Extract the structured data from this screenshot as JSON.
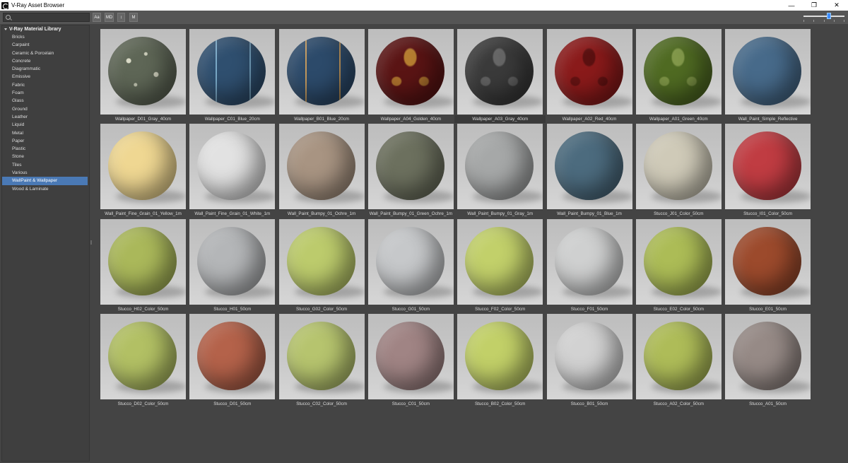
{
  "window": {
    "title": "V-Ray Asset Browser",
    "controls": [
      "—",
      "❐",
      "✕"
    ]
  },
  "toolbar": {
    "search_placeholder": "",
    "buttons": [
      "Aa",
      "MD",
      "↕",
      "M"
    ],
    "zoom_level": 0.62
  },
  "sidebar": {
    "root_label": "V-Ray Material Library",
    "items": [
      "Bricks",
      "Carpaint",
      "Ceramic & Porcelain",
      "Concrete",
      "Diagrammatic",
      "Emissive",
      "Fabric",
      "Foam",
      "Glass",
      "Ground",
      "Leather",
      "Liquid",
      "Metal",
      "Paper",
      "Plastic",
      "Stone",
      "Tiles",
      "Various",
      "WallPaint & Wallpaper",
      "Wood & Laminate"
    ],
    "selected_index": 18
  },
  "materials": [
    {
      "name": "Wallpaper_D01_Gray_40cm",
      "color": "#5e6656",
      "pattern": "flower"
    },
    {
      "name": "Wallpaper_C01_Blue_20cm",
      "color": "#2f4f6f",
      "pattern": "lines-blue"
    },
    {
      "name": "Wallpaper_B01_Blue_20cm",
      "color": "#2c4a6a",
      "pattern": "lines-gold"
    },
    {
      "name": "Wallpaper_A04_Golden_40cm",
      "color": "#5a1414",
      "pattern": "damask-gold"
    },
    {
      "name": "Wallpaper_A03_Gray_40cm",
      "color": "#3a3a3a",
      "pattern": "damask-gray"
    },
    {
      "name": "Wallpaper_A02_Red_40cm",
      "color": "#8a1a1a",
      "pattern": "damask-red"
    },
    {
      "name": "Wallpaper_A01_Green_40cm",
      "color": "#4f6a22",
      "pattern": "damask-green"
    },
    {
      "name": "Wall_Paint_Simple_Reflective",
      "color": "#476a8a",
      "pattern": "none"
    },
    {
      "name": "Wall_Paint_Fine_Grain_01_Yellow_1m",
      "color": "#efd792",
      "pattern": "none"
    },
    {
      "name": "Wall_Paint_Fine_Grain_01_White_1m",
      "color": "#e2e2e2",
      "pattern": "none"
    },
    {
      "name": "Wall_Paint_Bumpy_01_Ochre_1m",
      "color": "#a89482",
      "pattern": "none"
    },
    {
      "name": "Wall_Paint_Bumpy_01_Green_Ochre_1m",
      "color": "#6c705e",
      "pattern": "none"
    },
    {
      "name": "Wall_Paint_Bumpy_01_Gray_1m",
      "color": "#a6a8a8",
      "pattern": "none"
    },
    {
      "name": "Wall_Paint_Bumpy_01_Blue_1m",
      "color": "#4c6b7e",
      "pattern": "none"
    },
    {
      "name": "Stucco_J01_Color_50cm",
      "color": "#cfcab8",
      "pattern": "none"
    },
    {
      "name": "Stucco_I01_Color_50cm",
      "color": "#c03c42",
      "pattern": "none"
    },
    {
      "name": "Stucco_H02_Color_50cm",
      "color": "#aab85a",
      "pattern": "none"
    },
    {
      "name": "Stucco_H01_50cm",
      "color": "#b4b6b8",
      "pattern": "none"
    },
    {
      "name": "Stucco_G02_Color_50cm",
      "color": "#bccb6c",
      "pattern": "none"
    },
    {
      "name": "Stucco_G01_50cm",
      "color": "#c6c8ca",
      "pattern": "none"
    },
    {
      "name": "Stucco_F02_Color_50cm",
      "color": "#c2d06a",
      "pattern": "none"
    },
    {
      "name": "Stucco_F01_50cm",
      "color": "#cfd0d0",
      "pattern": "none"
    },
    {
      "name": "Stucco_E02_Color_50cm",
      "color": "#acbc56",
      "pattern": "none"
    },
    {
      "name": "Stucco_E01_50cm",
      "color": "#9c4a2c",
      "pattern": "none"
    },
    {
      "name": "Stucco_D02_Color_50cm",
      "color": "#b2c064",
      "pattern": "none"
    },
    {
      "name": "Stucco_D01_50cm",
      "color": "#b4624a",
      "pattern": "none"
    },
    {
      "name": "Stucco_C02_Color_50cm",
      "color": "#b6c46e",
      "pattern": "none"
    },
    {
      "name": "Stucco_C01_50cm",
      "color": "#a08484",
      "pattern": "none"
    },
    {
      "name": "Stucco_B02_Color_50cm",
      "color": "#c2d068",
      "pattern": "none"
    },
    {
      "name": "Stucco_B01_50cm",
      "color": "#d2d2d2",
      "pattern": "none"
    },
    {
      "name": "Stucco_A02_Color_50cm",
      "color": "#aebc58",
      "pattern": "none"
    },
    {
      "name": "Stucco_A01_50cm",
      "color": "#968a86",
      "pattern": "none"
    }
  ],
  "active_material_index": 4
}
